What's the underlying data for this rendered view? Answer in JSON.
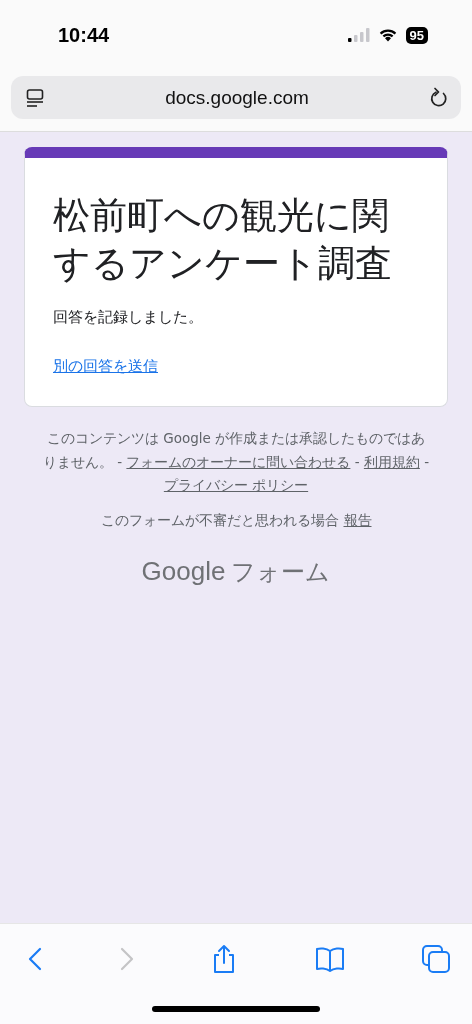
{
  "status_bar": {
    "time": "10:44",
    "battery": "95"
  },
  "address_bar": {
    "url": "docs.google.com"
  },
  "card": {
    "title": "松前町への観光に関するアンケート調査",
    "message": "回答を記録しました。",
    "link": "別の回答を送信"
  },
  "footer": {
    "disclaimer": [
      {
        "kind": "text",
        "text": "このコンテンツは Google が作成または承認したものではありません。 - "
      },
      {
        "kind": "link",
        "text": "フォームのオーナーに問い合わせる"
      },
      {
        "kind": "text",
        "text": " - "
      },
      {
        "kind": "link",
        "text": "利用規約"
      },
      {
        "kind": "text",
        "text": " - "
      },
      {
        "kind": "link",
        "text": "プライバシー ポリシー"
      }
    ],
    "report_text": "このフォームが不審だと思われる場合",
    "report_link": "報告",
    "logo_google": "Google",
    "logo_product": "フォーム"
  },
  "toolbar": [
    {
      "kind": "back",
      "disabled": false
    },
    {
      "kind": "forward",
      "disabled": true
    },
    {
      "kind": "share",
      "disabled": false
    },
    {
      "kind": "bookmarks",
      "disabled": false
    },
    {
      "kind": "tabs",
      "disabled": false
    }
  ]
}
